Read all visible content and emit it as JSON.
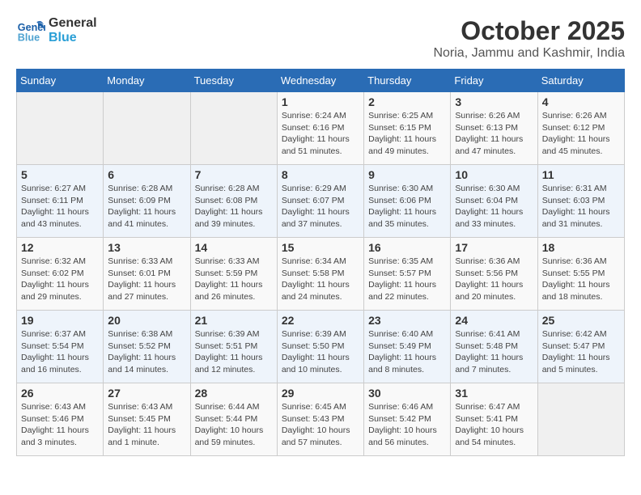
{
  "header": {
    "logo_line1": "General",
    "logo_line2": "Blue",
    "month": "October 2025",
    "location": "Noria, Jammu and Kashmir, India"
  },
  "days_of_week": [
    "Sunday",
    "Monday",
    "Tuesday",
    "Wednesday",
    "Thursday",
    "Friday",
    "Saturday"
  ],
  "weeks": [
    [
      {
        "day": "",
        "info": ""
      },
      {
        "day": "",
        "info": ""
      },
      {
        "day": "",
        "info": ""
      },
      {
        "day": "1",
        "info": "Sunrise: 6:24 AM\nSunset: 6:16 PM\nDaylight: 11 hours\nand 51 minutes."
      },
      {
        "day": "2",
        "info": "Sunrise: 6:25 AM\nSunset: 6:15 PM\nDaylight: 11 hours\nand 49 minutes."
      },
      {
        "day": "3",
        "info": "Sunrise: 6:26 AM\nSunset: 6:13 PM\nDaylight: 11 hours\nand 47 minutes."
      },
      {
        "day": "4",
        "info": "Sunrise: 6:26 AM\nSunset: 6:12 PM\nDaylight: 11 hours\nand 45 minutes."
      }
    ],
    [
      {
        "day": "5",
        "info": "Sunrise: 6:27 AM\nSunset: 6:11 PM\nDaylight: 11 hours\nand 43 minutes."
      },
      {
        "day": "6",
        "info": "Sunrise: 6:28 AM\nSunset: 6:09 PM\nDaylight: 11 hours\nand 41 minutes."
      },
      {
        "day": "7",
        "info": "Sunrise: 6:28 AM\nSunset: 6:08 PM\nDaylight: 11 hours\nand 39 minutes."
      },
      {
        "day": "8",
        "info": "Sunrise: 6:29 AM\nSunset: 6:07 PM\nDaylight: 11 hours\nand 37 minutes."
      },
      {
        "day": "9",
        "info": "Sunrise: 6:30 AM\nSunset: 6:06 PM\nDaylight: 11 hours\nand 35 minutes."
      },
      {
        "day": "10",
        "info": "Sunrise: 6:30 AM\nSunset: 6:04 PM\nDaylight: 11 hours\nand 33 minutes."
      },
      {
        "day": "11",
        "info": "Sunrise: 6:31 AM\nSunset: 6:03 PM\nDaylight: 11 hours\nand 31 minutes."
      }
    ],
    [
      {
        "day": "12",
        "info": "Sunrise: 6:32 AM\nSunset: 6:02 PM\nDaylight: 11 hours\nand 29 minutes."
      },
      {
        "day": "13",
        "info": "Sunrise: 6:33 AM\nSunset: 6:01 PM\nDaylight: 11 hours\nand 27 minutes."
      },
      {
        "day": "14",
        "info": "Sunrise: 6:33 AM\nSunset: 5:59 PM\nDaylight: 11 hours\nand 26 minutes."
      },
      {
        "day": "15",
        "info": "Sunrise: 6:34 AM\nSunset: 5:58 PM\nDaylight: 11 hours\nand 24 minutes."
      },
      {
        "day": "16",
        "info": "Sunrise: 6:35 AM\nSunset: 5:57 PM\nDaylight: 11 hours\nand 22 minutes."
      },
      {
        "day": "17",
        "info": "Sunrise: 6:36 AM\nSunset: 5:56 PM\nDaylight: 11 hours\nand 20 minutes."
      },
      {
        "day": "18",
        "info": "Sunrise: 6:36 AM\nSunset: 5:55 PM\nDaylight: 11 hours\nand 18 minutes."
      }
    ],
    [
      {
        "day": "19",
        "info": "Sunrise: 6:37 AM\nSunset: 5:54 PM\nDaylight: 11 hours\nand 16 minutes."
      },
      {
        "day": "20",
        "info": "Sunrise: 6:38 AM\nSunset: 5:52 PM\nDaylight: 11 hours\nand 14 minutes."
      },
      {
        "day": "21",
        "info": "Sunrise: 6:39 AM\nSunset: 5:51 PM\nDaylight: 11 hours\nand 12 minutes."
      },
      {
        "day": "22",
        "info": "Sunrise: 6:39 AM\nSunset: 5:50 PM\nDaylight: 11 hours\nand 10 minutes."
      },
      {
        "day": "23",
        "info": "Sunrise: 6:40 AM\nSunset: 5:49 PM\nDaylight: 11 hours\nand 8 minutes."
      },
      {
        "day": "24",
        "info": "Sunrise: 6:41 AM\nSunset: 5:48 PM\nDaylight: 11 hours\nand 7 minutes."
      },
      {
        "day": "25",
        "info": "Sunrise: 6:42 AM\nSunset: 5:47 PM\nDaylight: 11 hours\nand 5 minutes."
      }
    ],
    [
      {
        "day": "26",
        "info": "Sunrise: 6:43 AM\nSunset: 5:46 PM\nDaylight: 11 hours\nand 3 minutes."
      },
      {
        "day": "27",
        "info": "Sunrise: 6:43 AM\nSunset: 5:45 PM\nDaylight: 11 hours\nand 1 minute."
      },
      {
        "day": "28",
        "info": "Sunrise: 6:44 AM\nSunset: 5:44 PM\nDaylight: 10 hours\nand 59 minutes."
      },
      {
        "day": "29",
        "info": "Sunrise: 6:45 AM\nSunset: 5:43 PM\nDaylight: 10 hours\nand 57 minutes."
      },
      {
        "day": "30",
        "info": "Sunrise: 6:46 AM\nSunset: 5:42 PM\nDaylight: 10 hours\nand 56 minutes."
      },
      {
        "day": "31",
        "info": "Sunrise: 6:47 AM\nSunset: 5:41 PM\nDaylight: 10 hours\nand 54 minutes."
      },
      {
        "day": "",
        "info": ""
      }
    ]
  ]
}
